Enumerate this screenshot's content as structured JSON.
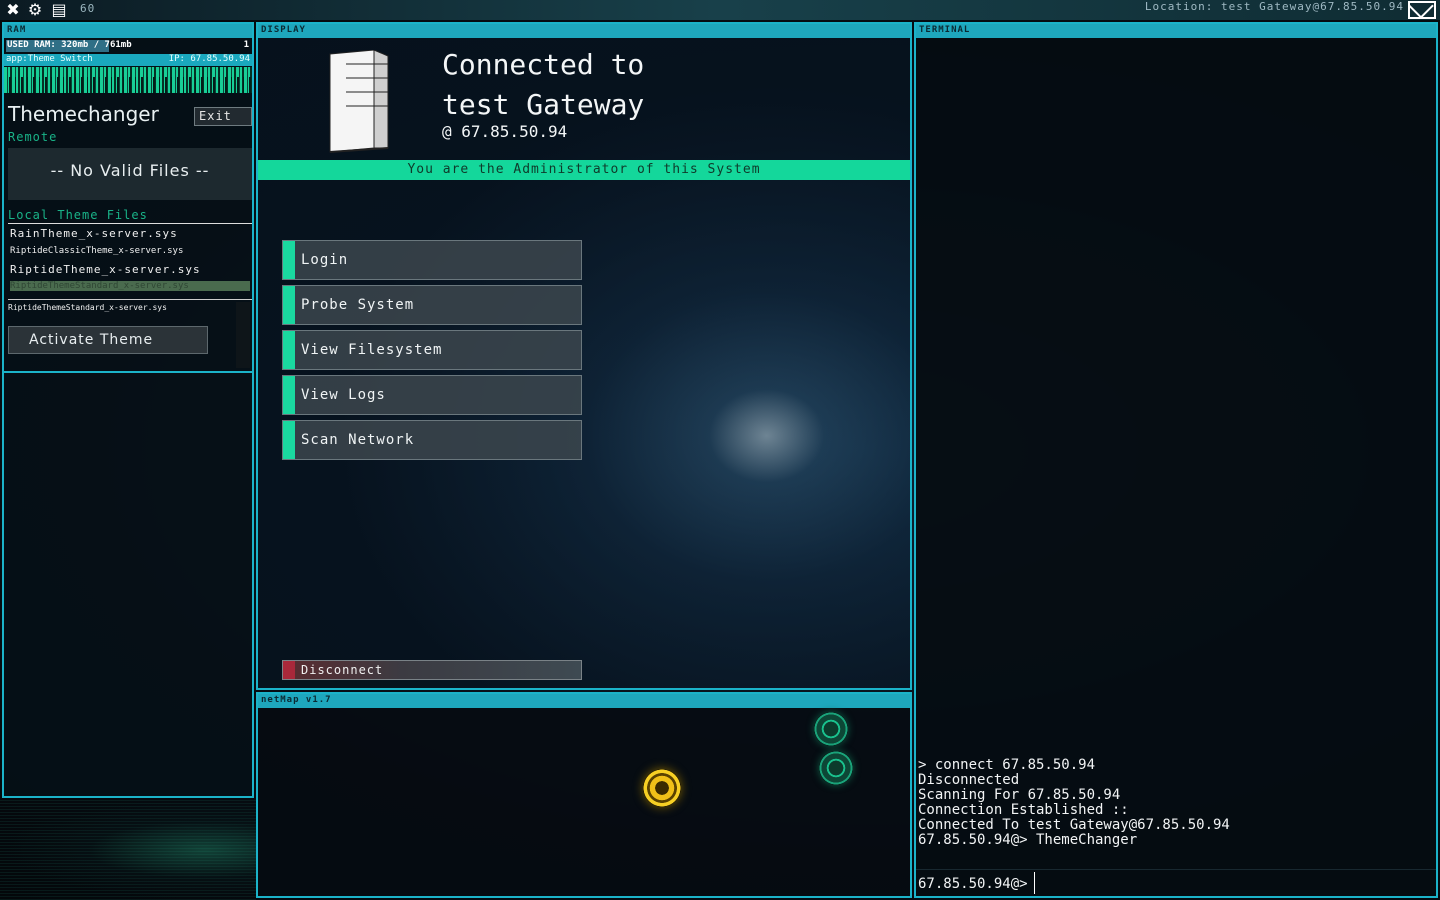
{
  "topbar": {
    "counter": "60",
    "location": "Location: test Gateway@67.85.50.94"
  },
  "ram": {
    "header": "RAM",
    "used_label": "USED RAM: 320mb / 761mb",
    "used_fraction": 0.42,
    "count": "1",
    "app_label": "app:Theme Switch",
    "ip_label": "IP: 67.85.50.94",
    "app_title": "Themechanger",
    "exit_label": "Exit",
    "remote_label": "Remote",
    "no_files": "-- No Valid Files --",
    "local_label": "Local Theme Files",
    "files": [
      "RainTheme_x-server.sys",
      "RiptideClassicTheme_x-server.sys",
      "RiptideTheme_x-server.sys",
      "RiptideThemeStandard_x-server.sys"
    ],
    "selected_file": "RiptideThemeStandard_x-server.sys",
    "activate_label": "Activate Theme"
  },
  "display": {
    "header": "DISPLAY",
    "connected_line1": "Connected to",
    "connected_line2": "test Gateway",
    "connected_ip": "@  67.85.50.94",
    "admin_banner": "You are the Administrator of this System",
    "menu": [
      {
        "label": "Login"
      },
      {
        "label": "Probe System"
      },
      {
        "label": "View Filesystem"
      },
      {
        "label": "View Logs"
      },
      {
        "label": "Scan Network"
      }
    ],
    "disconnect_label": "Disconnect"
  },
  "netmap": {
    "header": "netMap v1.7"
  },
  "terminal": {
    "header": "TERMINAL",
    "lines": [
      "> connect 67.85.50.94",
      "Disconnected",
      "Scanning For 67.85.50.94",
      "Connection Established ::",
      "Connected To test Gateway@67.85.50.94",
      "67.85.50.94@> ThemeChanger"
    ],
    "prompt": "67.85.50.94@>"
  },
  "colors": {
    "accent": "#1ea7bd",
    "highlight": "#14d79b",
    "danger": "#a8283a",
    "node_gold": "#f0c018",
    "node_green": "#19c18d"
  }
}
